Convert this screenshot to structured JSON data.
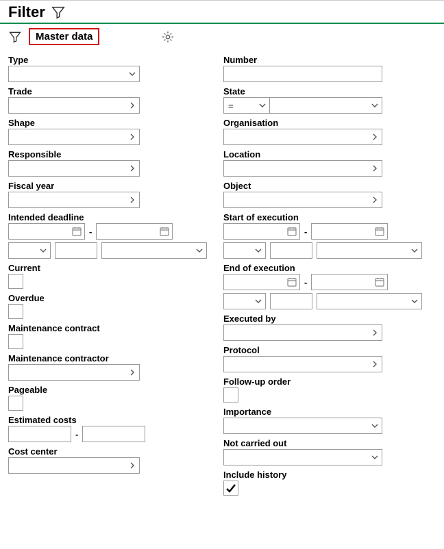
{
  "header": {
    "title": "Filter"
  },
  "tabs": {
    "master_data": "Master data"
  },
  "left": {
    "type": "Type",
    "trade": "Trade",
    "shape": "Shape",
    "responsible": "Responsible",
    "fiscal_year": "Fiscal year",
    "intended_deadline": "Intended deadline",
    "current": "Current",
    "overdue": "Overdue",
    "maintenance_contract": "Maintenance contract",
    "maintenance_contractor": "Maintenance contractor",
    "pageable": "Pageable",
    "estimated_costs": "Estimated costs",
    "cost_center": "Cost center"
  },
  "right": {
    "number": "Number",
    "state": "State",
    "state_op": "=",
    "organisation": "Organisation",
    "location": "Location",
    "object": "Object",
    "start_of_execution": "Start of execution",
    "end_of_execution": "End of execution",
    "executed_by": "Executed by",
    "protocol": "Protocol",
    "follow_up_order": "Follow-up order",
    "importance": "Importance",
    "not_carried_out": "Not carried out",
    "include_history": "Include history"
  },
  "values": {
    "include_history_checked": true
  }
}
